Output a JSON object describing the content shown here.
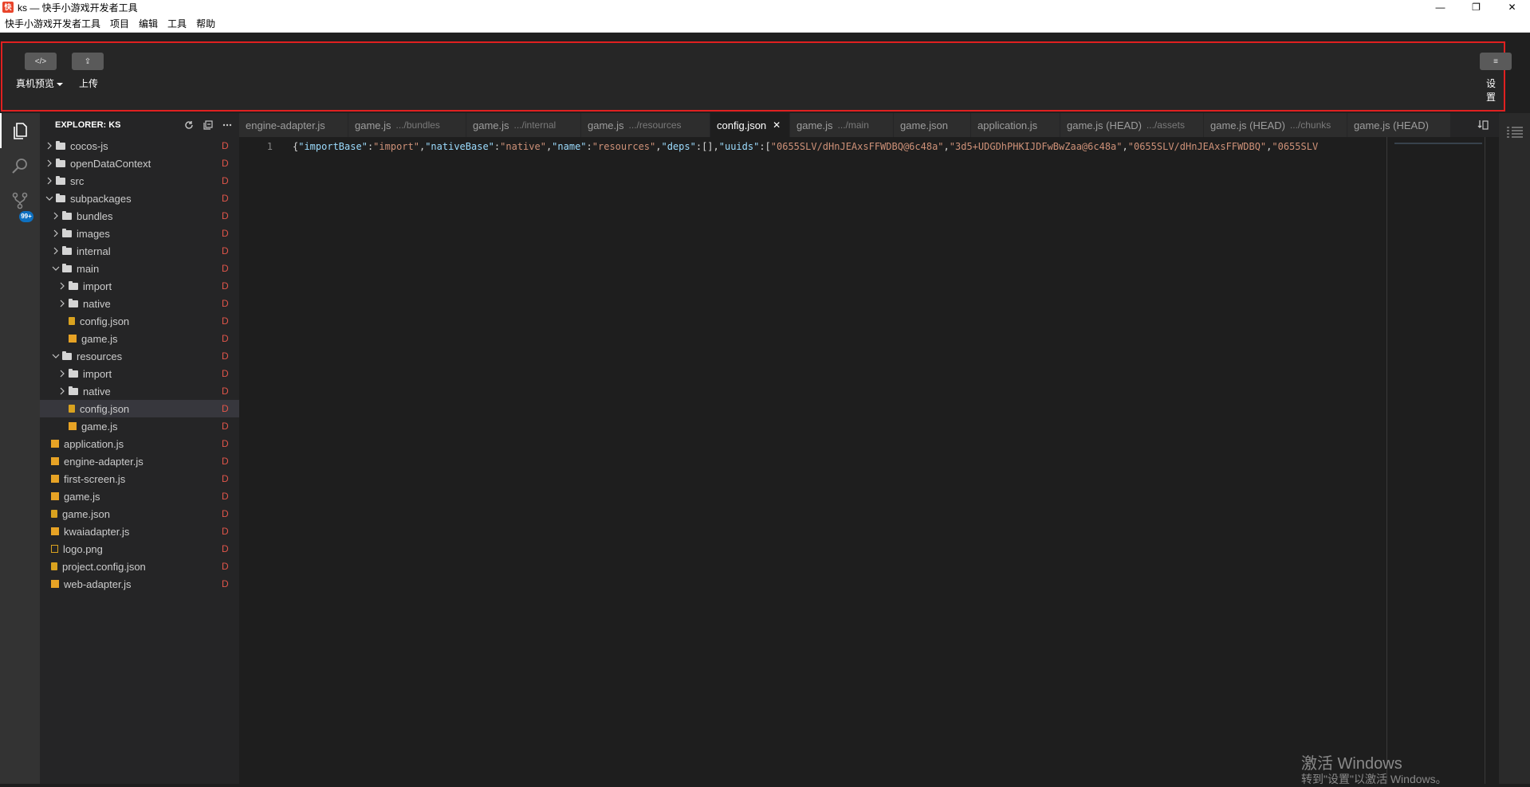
{
  "window": {
    "app_icon_glyph": "快",
    "title": "ks — 快手小游戏开发者工具",
    "minimize": "—",
    "maximize": "❐",
    "close": "✕"
  },
  "menubar": [
    "快手小游戏开发者工具",
    "项目",
    "编辑",
    "工具",
    "帮助"
  ],
  "toolbar": {
    "preview_label": "真机预览",
    "upload_label": "上传",
    "settings_label": "设置",
    "preview_icon": "</>",
    "upload_icon": "⇪",
    "settings_icon": "≡"
  },
  "activity": {
    "badge": "99+"
  },
  "explorer": {
    "title": "EXPLORER: KS",
    "status": "D",
    "items": [
      {
        "label": "cocos-js",
        "type": "folder",
        "expanded": false,
        "depth": 0
      },
      {
        "label": "openDataContext",
        "type": "folder",
        "expanded": false,
        "depth": 0
      },
      {
        "label": "src",
        "type": "folder",
        "expanded": false,
        "depth": 0
      },
      {
        "label": "subpackages",
        "type": "folder",
        "expanded": true,
        "depth": 0
      },
      {
        "label": "bundles",
        "type": "folder",
        "expanded": false,
        "depth": 1
      },
      {
        "label": "images",
        "type": "folder",
        "expanded": false,
        "depth": 1
      },
      {
        "label": "internal",
        "type": "folder",
        "expanded": false,
        "depth": 1
      },
      {
        "label": "main",
        "type": "folder",
        "expanded": true,
        "depth": 1
      },
      {
        "label": "import",
        "type": "folder",
        "expanded": false,
        "depth": 2
      },
      {
        "label": "native",
        "type": "folder",
        "expanded": false,
        "depth": 2
      },
      {
        "label": "config.json",
        "type": "json",
        "depth": 2
      },
      {
        "label": "game.js",
        "type": "js",
        "depth": 2
      },
      {
        "label": "resources",
        "type": "folder",
        "expanded": true,
        "depth": 1
      },
      {
        "label": "import",
        "type": "folder",
        "expanded": false,
        "depth": 2
      },
      {
        "label": "native",
        "type": "folder",
        "expanded": false,
        "depth": 2
      },
      {
        "label": "config.json",
        "type": "json",
        "depth": 2,
        "selected": true
      },
      {
        "label": "game.js",
        "type": "js",
        "depth": 2
      },
      {
        "label": "application.js",
        "type": "js",
        "depth": 0
      },
      {
        "label": "engine-adapter.js",
        "type": "js",
        "depth": 0
      },
      {
        "label": "first-screen.js",
        "type": "js",
        "depth": 0
      },
      {
        "label": "game.js",
        "type": "js",
        "depth": 0
      },
      {
        "label": "game.json",
        "type": "json",
        "depth": 0
      },
      {
        "label": "kwaiadapter.js",
        "type": "js",
        "depth": 0
      },
      {
        "label": "logo.png",
        "type": "png",
        "depth": 0
      },
      {
        "label": "project.config.json",
        "type": "json",
        "depth": 0
      },
      {
        "label": "web-adapter.js",
        "type": "js",
        "depth": 0
      }
    ]
  },
  "tabs": [
    {
      "label": "engine-adapter.js",
      "desc": ""
    },
    {
      "label": "game.js",
      "desc": ".../bundles"
    },
    {
      "label": "game.js",
      "desc": ".../internal"
    },
    {
      "label": "game.js",
      "desc": ".../resources"
    },
    {
      "label": "config.json",
      "desc": "",
      "active": true
    },
    {
      "label": "game.js",
      "desc": ".../main"
    },
    {
      "label": "game.json",
      "desc": ""
    },
    {
      "label": "application.js",
      "desc": ""
    },
    {
      "label": "game.js (HEAD)",
      "desc": ".../assets"
    },
    {
      "label": "game.js (HEAD)",
      "desc": ".../chunks"
    },
    {
      "label": "game.js (HEAD)",
      "desc": ""
    }
  ],
  "editor": {
    "line_number": "1",
    "code_tokens": [
      {
        "t": "{",
        "c": "brace"
      },
      {
        "t": "\"importBase\"",
        "c": "key"
      },
      {
        "t": ":",
        "c": "brace"
      },
      {
        "t": "\"import\"",
        "c": "str"
      },
      {
        "t": ",",
        "c": "brace"
      },
      {
        "t": "\"nativeBase\"",
        "c": "key"
      },
      {
        "t": ":",
        "c": "brace"
      },
      {
        "t": "\"native\"",
        "c": "str"
      },
      {
        "t": ",",
        "c": "brace"
      },
      {
        "t": "\"name\"",
        "c": "key"
      },
      {
        "t": ":",
        "c": "brace"
      },
      {
        "t": "\"resources\"",
        "c": "str"
      },
      {
        "t": ",",
        "c": "brace"
      },
      {
        "t": "\"deps\"",
        "c": "key"
      },
      {
        "t": ":[],",
        "c": "brace"
      },
      {
        "t": "\"uuids\"",
        "c": "key"
      },
      {
        "t": ":[",
        "c": "brace"
      },
      {
        "t": "\"0655SLV/dHnJEAxsFFWDBQ@6c48a\"",
        "c": "str"
      },
      {
        "t": ",",
        "c": "brace"
      },
      {
        "t": "\"3d5+UDGDhPHKIJDFwBwZaa@6c48a\"",
        "c": "str"
      },
      {
        "t": ",",
        "c": "brace"
      },
      {
        "t": "\"0655SLV/dHnJEAxsFFWDBQ\"",
        "c": "str"
      },
      {
        "t": ",",
        "c": "brace"
      },
      {
        "t": "\"0655SLV",
        "c": "str"
      }
    ]
  },
  "watermark": {
    "line1": "激活 Windows",
    "line2": "转到\"设置\"以激活 Windows。"
  }
}
